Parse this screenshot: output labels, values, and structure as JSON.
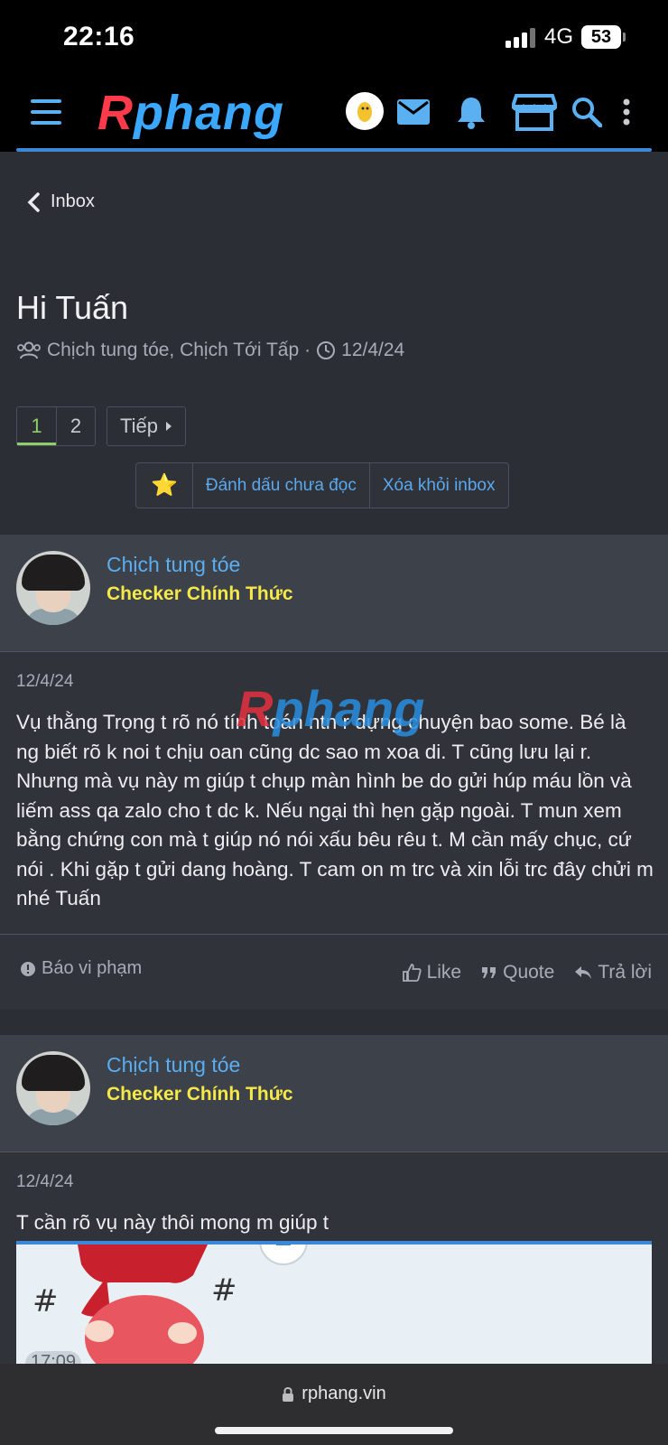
{
  "status_bar": {
    "time": "22:16",
    "network": "4G",
    "battery": "53"
  },
  "nav": {
    "logo_r": "R",
    "logo_rest": "phang",
    "icons": [
      "menu-icon",
      "avatar",
      "mail-icon",
      "bell-icon",
      "store-icon",
      "search-icon",
      "more-icon"
    ]
  },
  "conversation": {
    "back_label": "Inbox",
    "title": "Hi Tuấn",
    "participants": "Chịch tung tóe, Chịch Tới Tấp",
    "separator": "·",
    "date": "12/4/24"
  },
  "pagination": {
    "pages": [
      "1",
      "2"
    ],
    "current": "1",
    "next_label": "Tiếp"
  },
  "actions": {
    "star": "⭐",
    "mark_unread": "Đánh dấu chưa đọc",
    "remove": "Xóa khỏi inbox"
  },
  "messages": [
    {
      "author": "Chịch tung tóe",
      "role": "Checker Chính Thức",
      "date": "12/4/24",
      "text": "Vụ thằng Trọng t rõ nó tính toán ntn r dựng chuyện bao some. Bé là ng biết rõ k noi t chịu oan cũng dc sao m xoa di. T cũng lưu lại r. Nhưng mà vụ này m giúp t chụp màn hình be do gửi húp máu lồn và liếm ass qa zalo cho t dc k. Nếu ngại thì hẹn gặp ngoài. T mun xem bằng chứng con mà t giúp nó nói xấu bêu rêu t. M cần mấy chục, cứ nói . Khi gặp t gửi dang hoàng. T cam on m trc và xin lỗi trc đây chửi m nhé Tuấn",
      "report": "Báo vi phạm",
      "like": "Like",
      "quote": "Quote",
      "reply": "Trả lời"
    },
    {
      "author": "Chịch tung tóe",
      "role": "Checker Chính Thức",
      "date": "12/4/24",
      "text": "T cần rõ vụ này thôi mong m giúp t",
      "attachment_time": "17:09"
    }
  ],
  "watermark": {
    "r": "R",
    "rest": "phang"
  },
  "browser": {
    "url": "rphang.vin"
  },
  "colors": {
    "accent_blue": "#5aaef2",
    "role_yellow": "#f5e94a",
    "page_green": "#8fcf6a",
    "background": "#2b2e34"
  }
}
